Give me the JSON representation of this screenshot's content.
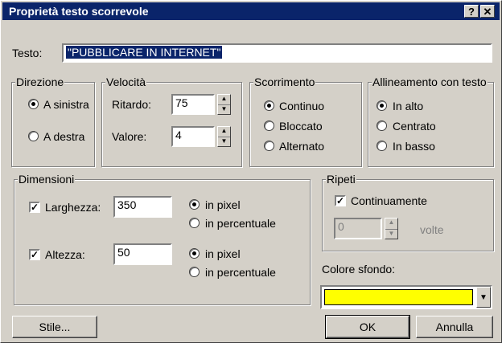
{
  "title": "Proprietà testo scorrevole",
  "title_buttons": {
    "help": "?",
    "close": "✕"
  },
  "testo": {
    "label": "Testo:",
    "value": "\"PUBBLICARE IN INTERNET\""
  },
  "direzione": {
    "legend": "Direzione",
    "options": [
      "A sinistra",
      "A destra"
    ],
    "selected": 0
  },
  "velocita": {
    "legend": "Velocità",
    "ritardo_label": "Ritardo:",
    "ritardo_value": "75",
    "valore_label": "Valore:",
    "valore_value": "4"
  },
  "scorrimento": {
    "legend": "Scorrimento",
    "options": [
      "Continuo",
      "Bloccato",
      "Alternato"
    ],
    "selected": 0
  },
  "allineamento": {
    "legend": "Allineamento con testo",
    "options": [
      "In alto",
      "Centrato",
      "In basso"
    ],
    "selected": 0
  },
  "dimensioni": {
    "legend": "Dimensioni",
    "larghezza": {
      "label": "Larghezza:",
      "checked": true,
      "value": "350",
      "options": [
        "in pixel",
        "in percentuale"
      ],
      "selected": 0
    },
    "altezza": {
      "label": "Altezza:",
      "checked": true,
      "value": "50",
      "options": [
        "in pixel",
        "in percentuale"
      ],
      "selected": 0
    }
  },
  "ripeti": {
    "legend": "Ripeti",
    "checkbox_label": "Continuamente",
    "checked": true,
    "count_value": "0",
    "volte_label": "volte"
  },
  "colore": {
    "label": "Colore sfondo:",
    "value_color": "#ffff00"
  },
  "buttons": {
    "stile": "Stile...",
    "ok": "OK",
    "annulla": "Annulla"
  },
  "colors": {
    "titlebar": "#0a246a",
    "face": "#d4d0c8",
    "selection": "#0a246a"
  }
}
